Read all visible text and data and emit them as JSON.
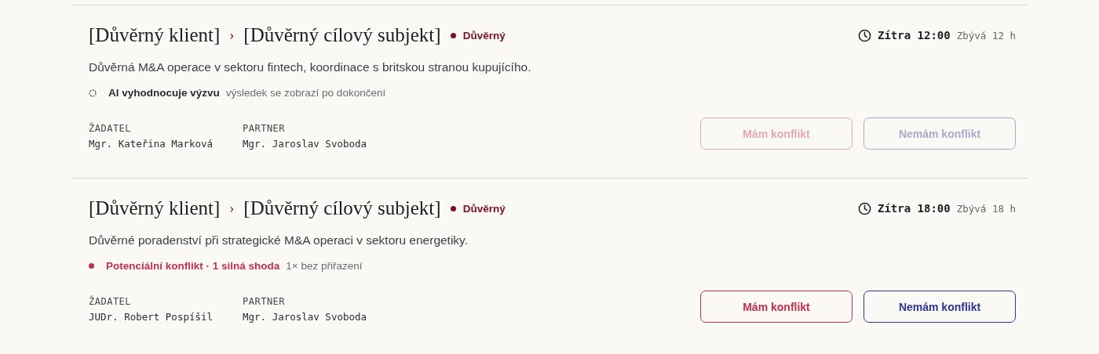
{
  "requests": [
    {
      "client": "[Důvěrný klient]",
      "separator": "›",
      "target": "[Důvěrný cílový subjekt]",
      "badge": "Důvěrný",
      "deadline": "Zítra 12:00",
      "remaining": "Zbývá 12 h",
      "description": "Důvěrná M&A operace v sektoru fintech, koordinace s britskou stranou kupujícího.",
      "status": {
        "kind": "pending",
        "label": "AI vyhodnocuje výzvu",
        "note": "výsledek se zobrazí po dokončení"
      },
      "people": [
        {
          "role": "ŽADATEL",
          "name": "Mgr. Kateřina Marková"
        },
        {
          "role": "PARTNER",
          "name": "Mgr. Jaroslav Svoboda"
        }
      ],
      "buttons": [
        {
          "kind": "conflict",
          "label": "Mám konflikt",
          "disabled": true
        },
        {
          "kind": "clear",
          "label": "Nemám konflikt",
          "disabled": true
        }
      ]
    },
    {
      "client": "[Důvěrný klient]",
      "separator": "›",
      "target": "[Důvěrný cílový subjekt]",
      "badge": "Důvěrný",
      "deadline": "Zítra 18:00",
      "remaining": "Zbývá 18 h",
      "description": "Důvěrné poradenství při strategické M&A operaci v sektoru energetiky.",
      "status": {
        "kind": "conflict",
        "label": "Potenciální konflikt · 1 silná shoda",
        "note": "1× bez přiřazení"
      },
      "people": [
        {
          "role": "ŽADATEL",
          "name": "JUDr. Robert Pospíšil"
        },
        {
          "role": "PARTNER",
          "name": "Mgr. Jaroslav Svoboda"
        }
      ],
      "buttons": [
        {
          "kind": "conflict",
          "label": "Mám konflikt",
          "disabled": false
        },
        {
          "kind": "clear",
          "label": "Nemám konflikt",
          "disabled": false
        }
      ]
    }
  ]
}
